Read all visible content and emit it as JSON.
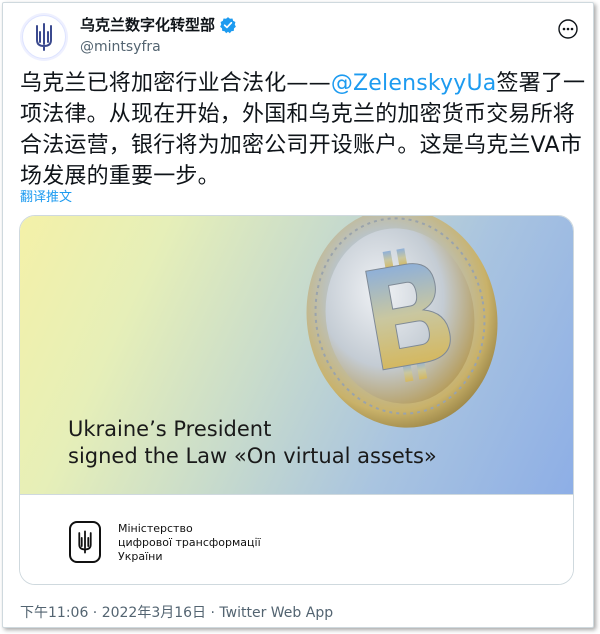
{
  "account": {
    "display_name": "乌克兰数字化转型部",
    "handle": "@mintsyfra",
    "verified": true
  },
  "tweet": {
    "text_before_mention": "乌克兰已将加密行业合法化——",
    "mention": "@ZelenskyyUa",
    "text_after_mention": "签署了一项法律。从现在开始，外国和乌克兰的加密货币交易所将合法运营，银行将为加密公司开设账户。这是乌克兰VA市场发展的重要一步。",
    "translate_label": "翻译推文"
  },
  "card": {
    "title_line1": "Ukraine’s President",
    "title_line2": "signed the Law «On virtual assets»",
    "ministry_line1": "Міністерство",
    "ministry_line2": "цифрової трансформації",
    "ministry_line3": "України"
  },
  "meta": {
    "text": "下午11:06 · 2022年3月16日 · Twitter Web App"
  },
  "colors": {
    "link": "#1d9bf0",
    "verified": "#1d9bf0",
    "muted": "#536471"
  },
  "icons": [
    "trident-emblem-icon",
    "verified-badge-icon",
    "more-options-icon",
    "bitcoin-coin-image"
  ]
}
